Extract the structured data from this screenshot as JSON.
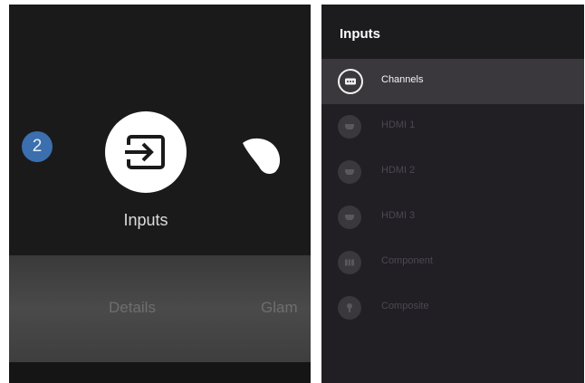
{
  "home": {
    "badge_number": "2",
    "selected_label": "Inputs",
    "lower_items": [
      "Details",
      "Glam"
    ]
  },
  "inputs_menu": {
    "title": "Inputs",
    "items": [
      {
        "label": "Channels",
        "icon": "tv-tuner-icon",
        "selected": true
      },
      {
        "label": "HDMI 1",
        "icon": "hdmi-icon",
        "selected": false
      },
      {
        "label": "HDMI 2",
        "icon": "hdmi-icon",
        "selected": false
      },
      {
        "label": "HDMI 3",
        "icon": "hdmi-icon",
        "selected": false
      },
      {
        "label": "Component",
        "icon": "component-icon",
        "selected": false
      },
      {
        "label": "Composite",
        "icon": "composite-icon",
        "selected": false
      }
    ]
  },
  "colors": {
    "badge_blue": "#3b6fae",
    "selected_row": "#3a383d",
    "panel_bg": "#211f24"
  }
}
